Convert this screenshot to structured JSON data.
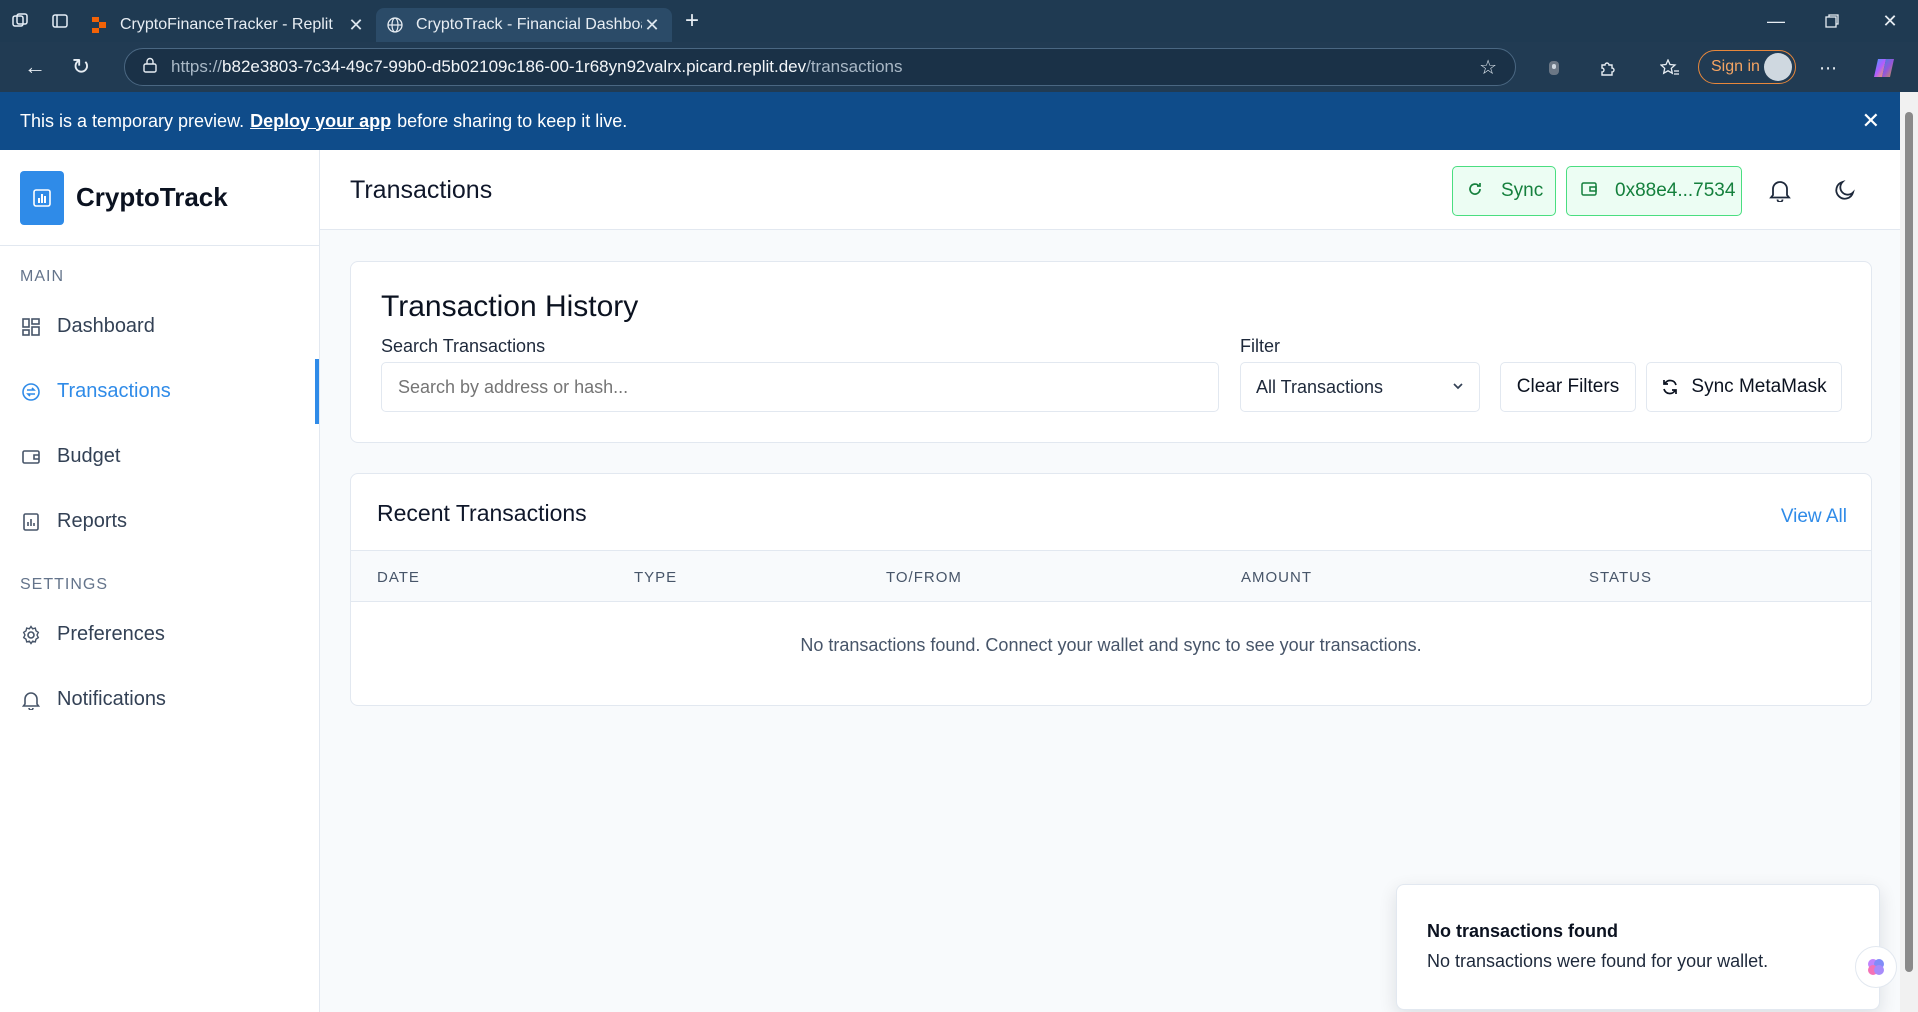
{
  "browser": {
    "tabs": [
      {
        "title": "CryptoFinanceTracker - Replit",
        "favicon": "replit-icon"
      },
      {
        "title": "CryptoTrack - Financial Dashboard",
        "favicon": "globe-icon"
      }
    ],
    "url_prefix": "https://",
    "url_host": "b82e3803-7c34-49c7-99b0-d5b02109c186-00-1r68yn92valrx.picard.replit.dev",
    "url_path": "/transactions",
    "signin_label": "Sign in"
  },
  "preview_banner": {
    "text_before": "This is a temporary preview.",
    "link": "Deploy your app",
    "text_after": "before sharing to keep it live."
  },
  "sidebar": {
    "brand": "CryptoTrack",
    "main_label": "MAIN",
    "settings_label": "SETTINGS",
    "main_items": [
      {
        "label": "Dashboard",
        "icon": "dashboard-icon"
      },
      {
        "label": "Transactions",
        "icon": "transactions-icon",
        "active": true
      },
      {
        "label": "Budget",
        "icon": "wallet-icon"
      },
      {
        "label": "Reports",
        "icon": "report-icon"
      }
    ],
    "settings_items": [
      {
        "label": "Preferences",
        "icon": "gear-icon"
      },
      {
        "label": "Notifications",
        "icon": "bell-icon"
      }
    ]
  },
  "header": {
    "title": "Transactions",
    "sync_label": "Sync",
    "wallet_label": "0x88e4...7534"
  },
  "history": {
    "title": "Transaction History",
    "search_label": "Search Transactions",
    "search_placeholder": "Search by address or hash...",
    "filter_label": "Filter",
    "filter_value": "All Transactions",
    "clear_label": "Clear Filters",
    "sync_metamask_label": "Sync MetaMask"
  },
  "recent": {
    "title": "Recent Transactions",
    "view_all": "View All",
    "columns": [
      "DATE",
      "TYPE",
      "TO/FROM",
      "AMOUNT",
      "STATUS"
    ],
    "empty_text": "No transactions found. Connect your wallet and sync to see your transactions."
  },
  "toast": {
    "title": "No transactions found",
    "body": "No transactions were found for your wallet."
  },
  "colors": {
    "accent": "#2f8be8",
    "banner": "#0f4c8a",
    "success": "#15803d"
  }
}
